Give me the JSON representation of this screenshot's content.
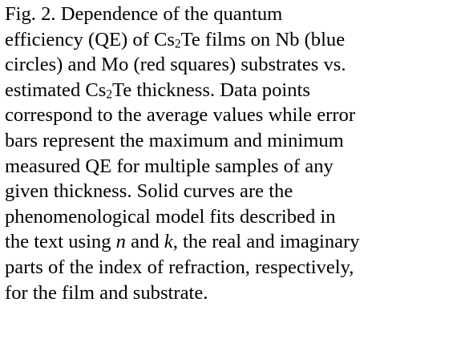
{
  "caption": {
    "lines": [
      [
        "Fig. 2.  Dependence of the quantum"
      ],
      [
        "efficiency (QE) of Cs",
        {
          "sub": "2"
        },
        "Te films on Nb (blue"
      ],
      [
        "circles) and Mo (red squares) substrates vs."
      ],
      [
        "estimated Cs",
        {
          "sub": "2"
        },
        "Te thickness.  Data points"
      ],
      [
        "correspond to the average values while error"
      ],
      [
        "bars represent the maximum and minimum"
      ],
      [
        "measured QE for multiple samples of any"
      ],
      [
        "given thickness.  Solid curves are the"
      ],
      [
        "phenomenological model fits described in"
      ],
      [
        "the text using ",
        {
          "i": "n"
        },
        " and ",
        {
          "i": "k"
        },
        ", the real and imaginary"
      ],
      [
        "parts of the index of refraction, respectively,"
      ],
      [
        "for the film and substrate."
      ]
    ]
  }
}
